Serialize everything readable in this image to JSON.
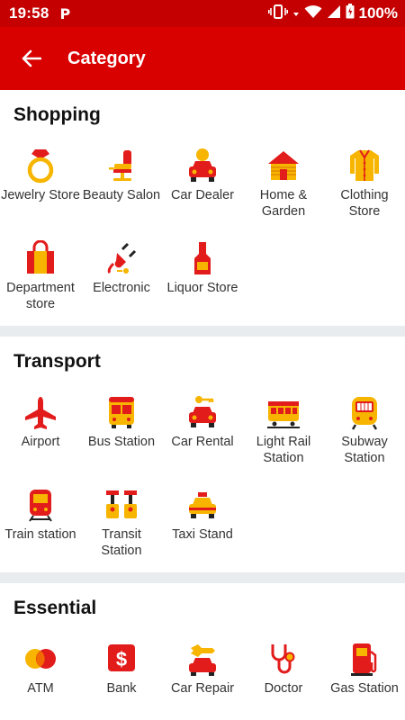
{
  "status_bar": {
    "time": "19:58",
    "app_icon_letter": "P",
    "battery": "100%"
  },
  "app_bar": {
    "title": "Category"
  },
  "sections": [
    {
      "title": "Shopping",
      "items": [
        {
          "label": "Jewelry Store",
          "icon": "ring-icon"
        },
        {
          "label": "Beauty Salon",
          "icon": "salon-chair-icon"
        },
        {
          "label": "Car Dealer",
          "icon": "car-dealer-icon"
        },
        {
          "label": "Home & Garden",
          "icon": "cabin-icon"
        },
        {
          "label": "Clothing Store",
          "icon": "shirt-icon"
        },
        {
          "label": "Department store",
          "icon": "shopping-bag-icon"
        },
        {
          "label": "Electronic",
          "icon": "plug-icon"
        },
        {
          "label": "Liquor Store",
          "icon": "bottle-icon"
        }
      ]
    },
    {
      "title": "Transport",
      "items": [
        {
          "label": "Airport",
          "icon": "airplane-icon"
        },
        {
          "label": "Bus Station",
          "icon": "bus-icon"
        },
        {
          "label": "Car Rental",
          "icon": "car-key-icon"
        },
        {
          "label": "Light Rail Station",
          "icon": "tram-icon"
        },
        {
          "label": "Subway Station",
          "icon": "subway-icon"
        },
        {
          "label": "Train station",
          "icon": "train-icon"
        },
        {
          "label": "Transit Station",
          "icon": "transit-icon"
        },
        {
          "label": "Taxi Stand",
          "icon": "taxi-icon"
        }
      ]
    },
    {
      "title": "Essential",
      "items": [
        {
          "label": "ATM",
          "icon": "card-icon"
        },
        {
          "label": "Bank",
          "icon": "bank-dollar-icon"
        },
        {
          "label": "Car Repair",
          "icon": "car-repair-icon"
        },
        {
          "label": "Doctor",
          "icon": "stethoscope-icon"
        },
        {
          "label": "Gas Station",
          "icon": "fuel-pump-icon"
        }
      ]
    }
  ],
  "colors": {
    "status_bar": "#c40000",
    "app_bar": "#d90000",
    "icon_red": "#e21b1b",
    "icon_yellow": "#f7b500",
    "divider": "#e8ecef"
  }
}
